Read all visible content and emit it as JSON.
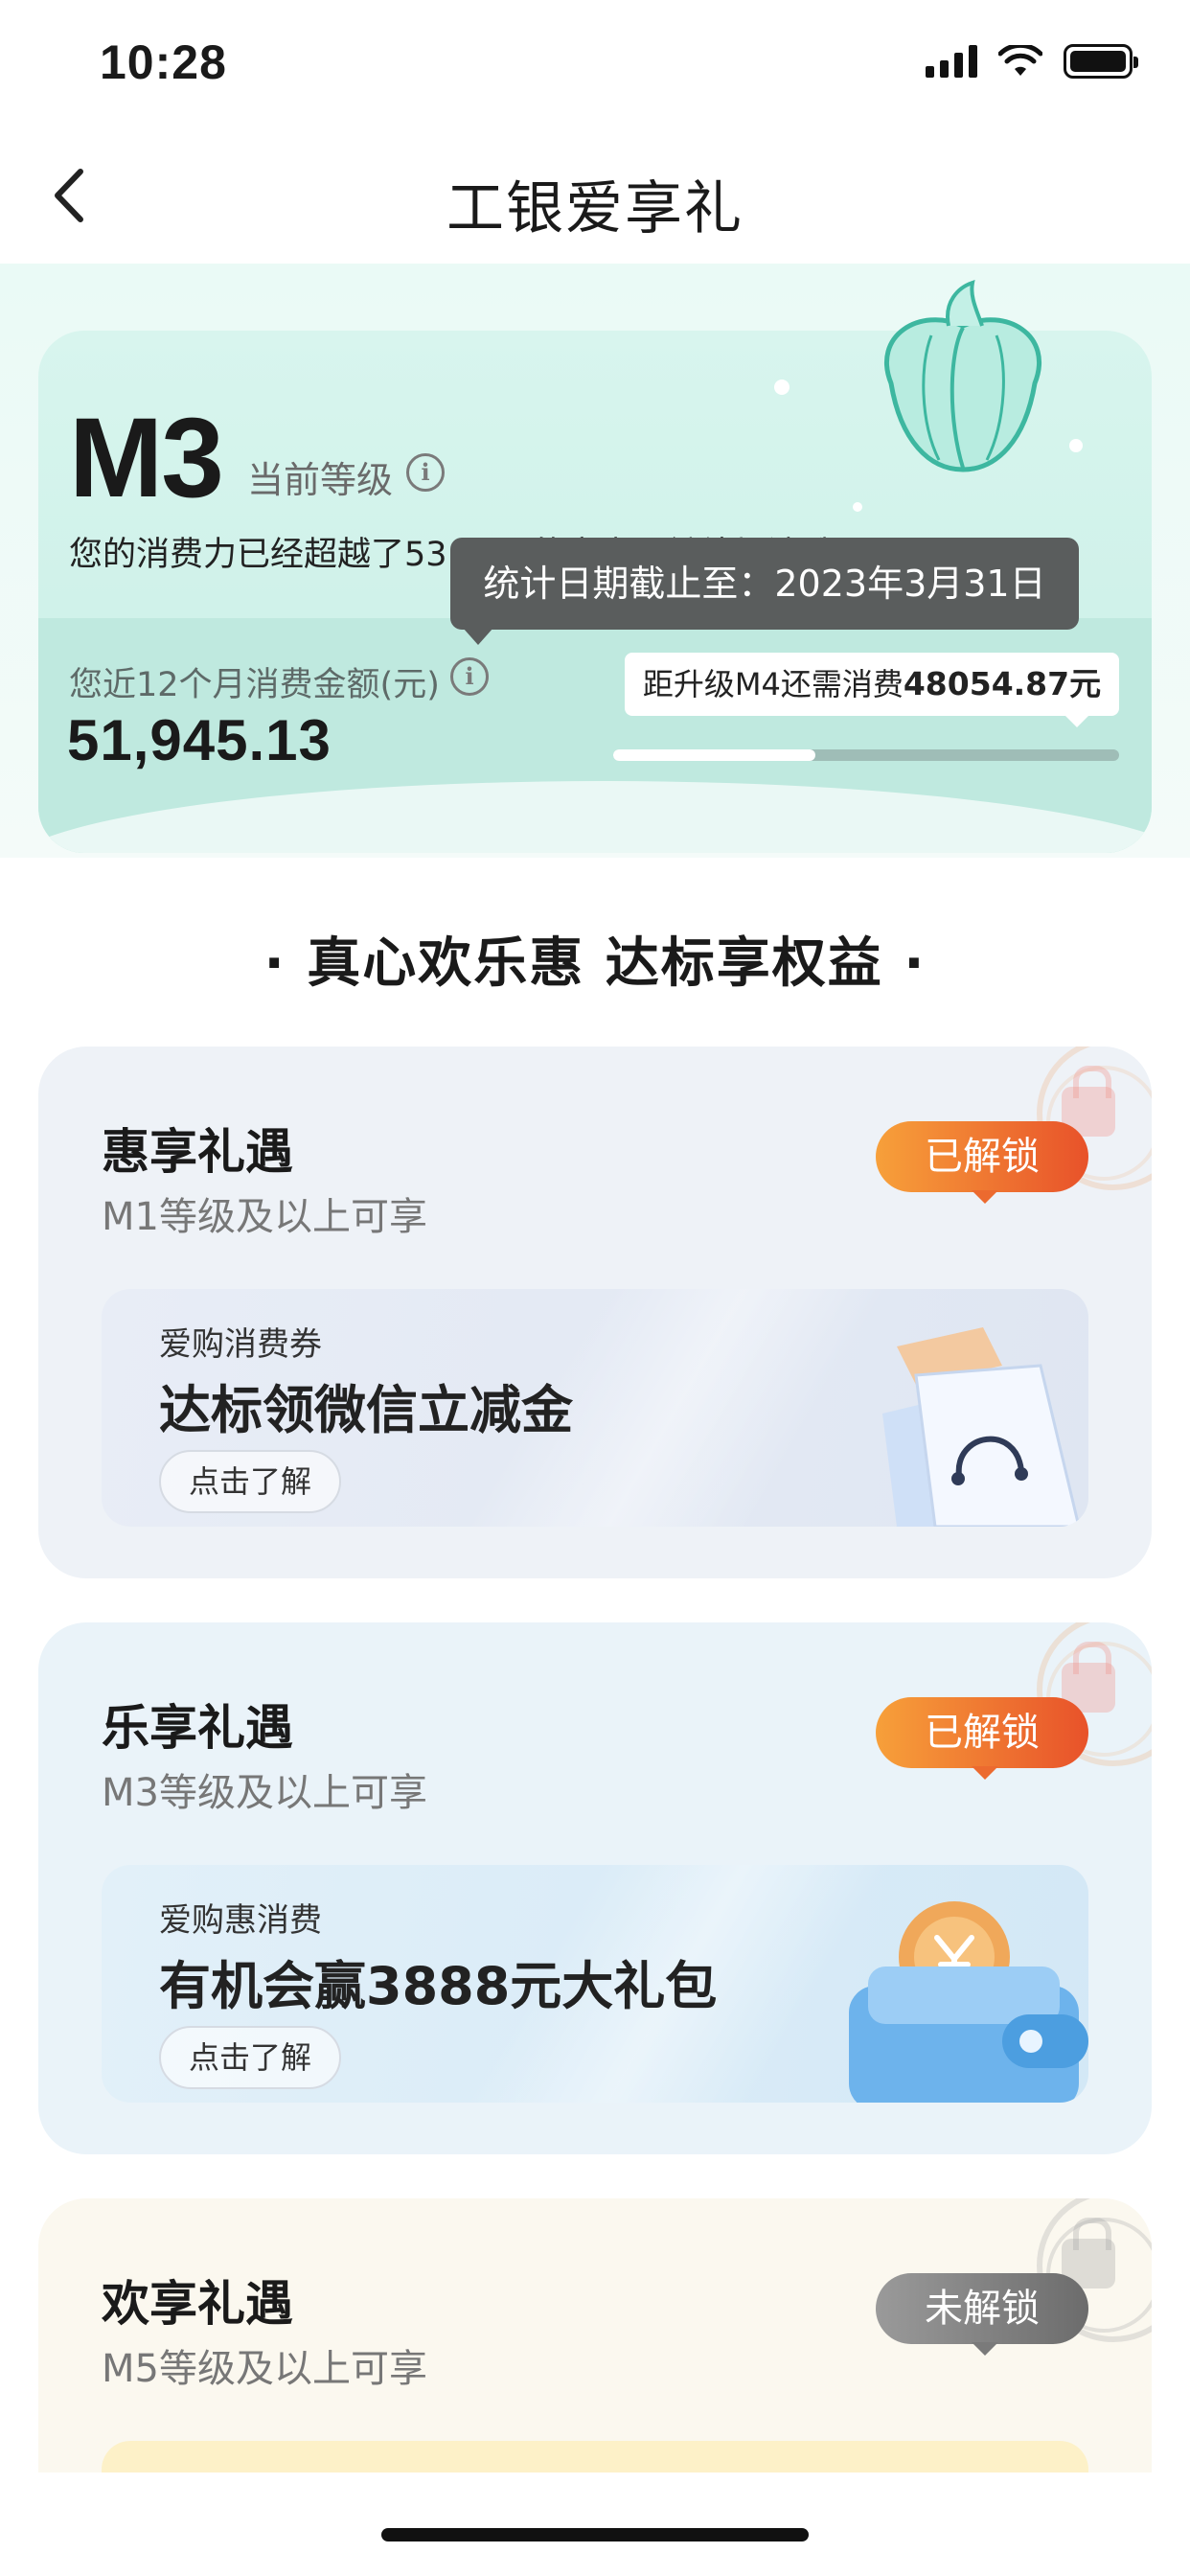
{
  "status": {
    "time": "10:28"
  },
  "nav": {
    "title": "工银爱享礼"
  },
  "level": {
    "code": "M3",
    "caption": "当前等级",
    "beat_text": "您的消费力已经超越了53.29%的客户，继续加油哦！",
    "tooltip": "统计日期截止至：2023年3月31日",
    "spend_label": "您近12个月消费金额(元)",
    "spend_amount": "51,945.13",
    "upgrade_prefix": "距升级M4还需消费",
    "upgrade_amount": "48054.87元",
    "progress_fraction": 0.4
  },
  "section_title": "· 真心欢乐惠 达标享权益 ·",
  "benefits": [
    {
      "title": "惠享礼遇",
      "subtitle": "M1等级及以上可享",
      "badge": "已解锁",
      "offer_tag": "爱购消费券",
      "offer_title": "达标领微信立减金",
      "offer_button": "点击了解"
    },
    {
      "title": "乐享礼遇",
      "subtitle": "M3等级及以上可享",
      "badge": "已解锁",
      "offer_tag": "爱购惠消费",
      "offer_title": "有机会赢3888元大礼包",
      "offer_button": "点击了解"
    },
    {
      "title": "欢享礼遇",
      "subtitle": "M5等级及以上可享",
      "badge": "未解锁"
    }
  ],
  "colors": {
    "accent_mint": "#c9efe6",
    "badge_unlocked": "#ec6a2f",
    "badge_locked": "#7a7a7a"
  }
}
